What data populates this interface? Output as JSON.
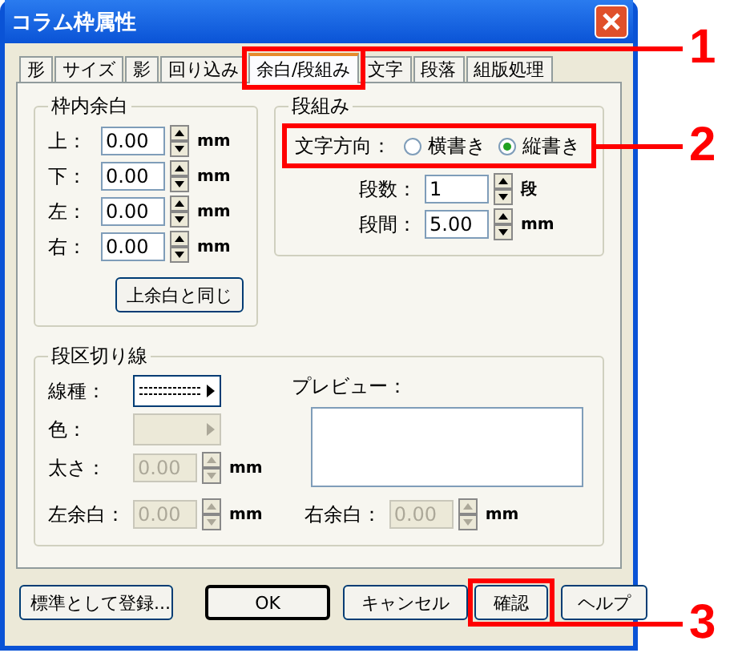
{
  "window": {
    "title": "コラム枠属性"
  },
  "tabs": [
    {
      "label": "形",
      "selected": false
    },
    {
      "label": "サイズ",
      "selected": false
    },
    {
      "label": "影",
      "selected": false
    },
    {
      "label": "回り込み",
      "selected": false
    },
    {
      "label": "余白/段組み",
      "selected": true
    },
    {
      "label": "文字",
      "selected": false
    },
    {
      "label": "段落",
      "selected": false
    },
    {
      "label": "組版処理",
      "selected": false
    }
  ],
  "inner_margin": {
    "title": "枠内余白",
    "fields": [
      {
        "label": "上：",
        "value": "0.00",
        "unit": "mm"
      },
      {
        "label": "下：",
        "value": "0.00",
        "unit": "mm"
      },
      {
        "label": "左：",
        "value": "0.00",
        "unit": "mm"
      },
      {
        "label": "右：",
        "value": "0.00",
        "unit": "mm"
      }
    ],
    "button": "上余白と同じ"
  },
  "columns": {
    "title": "段組み",
    "direction": {
      "label": "文字方向：",
      "options": [
        {
          "label": "横書き",
          "selected": false
        },
        {
          "label": "縦書き",
          "selected": true
        }
      ]
    },
    "fields": [
      {
        "label": "段数：",
        "value": "1",
        "unit": "段"
      },
      {
        "label": "段間：",
        "value": "5.00",
        "unit": "mm"
      }
    ]
  },
  "divider": {
    "title": "段区切り線",
    "line_type": {
      "label": "線種：",
      "disabled": false
    },
    "color": {
      "label": "色：",
      "disabled": true
    },
    "width": {
      "label": "太さ：",
      "value": "0.00",
      "unit": "mm",
      "disabled": true
    },
    "left_margin": {
      "label": "左余白：",
      "value": "0.00",
      "unit": "mm",
      "disabled": true
    },
    "right_margin": {
      "label": "右余白：",
      "value": "0.00",
      "unit": "mm",
      "disabled": true
    },
    "preview": {
      "label": "プレビュー："
    }
  },
  "buttons": [
    {
      "label": "標準として登録...",
      "default": false
    },
    {
      "label": "OK",
      "default": true
    },
    {
      "label": "キャンセル",
      "default": false
    },
    {
      "label": "確認",
      "default": false
    },
    {
      "label": "ヘルプ",
      "default": false
    }
  ],
  "callouts": [
    {
      "number": "1"
    },
    {
      "number": "2"
    },
    {
      "number": "3"
    }
  ]
}
